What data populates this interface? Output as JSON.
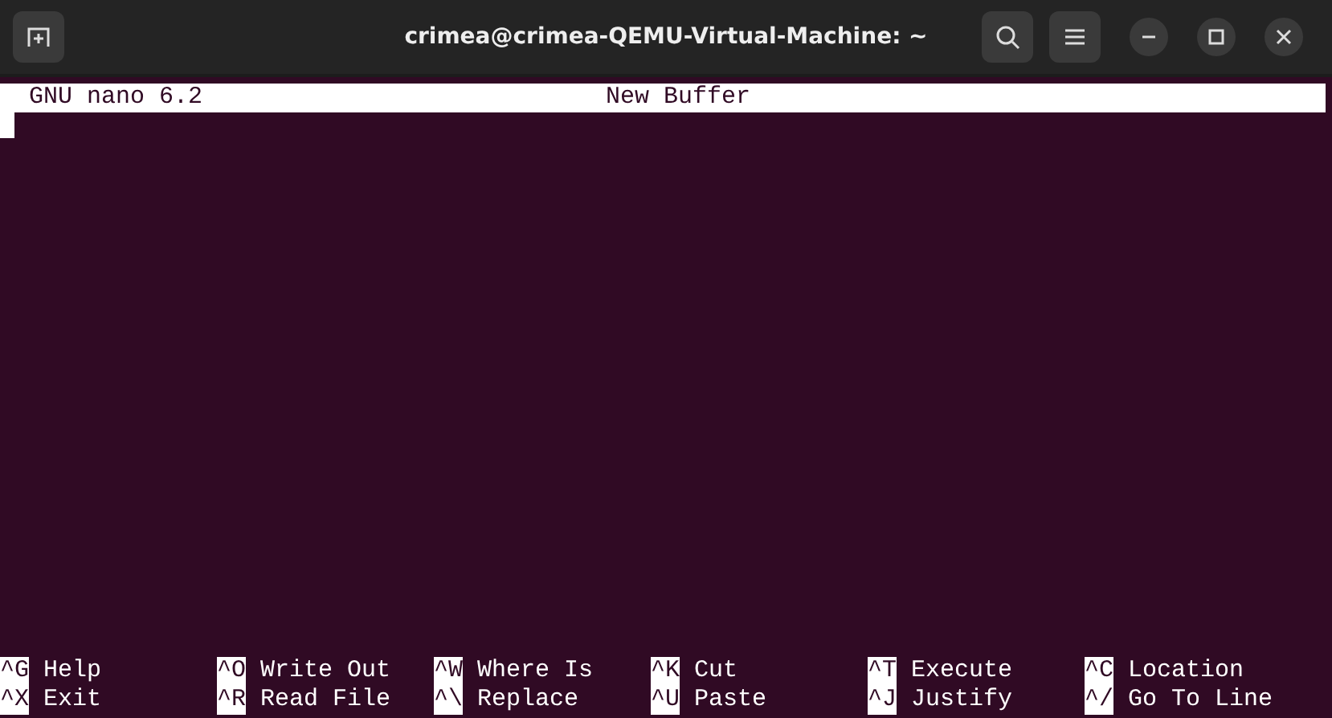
{
  "window": {
    "title": "crimea@crimea-QEMU-Virtual-Machine: ~"
  },
  "nano": {
    "version": "GNU nano 6.2",
    "buffer": "New Buffer"
  },
  "shortcuts": [
    [
      {
        "key": "^G",
        "label": "Help"
      },
      {
        "key": "^O",
        "label": "Write Out"
      },
      {
        "key": "^W",
        "label": "Where Is"
      },
      {
        "key": "^K",
        "label": "Cut"
      },
      {
        "key": "^T",
        "label": "Execute"
      },
      {
        "key": "^C",
        "label": "Location"
      }
    ],
    [
      {
        "key": "^X",
        "label": "Exit"
      },
      {
        "key": "^R",
        "label": "Read File"
      },
      {
        "key": "^\\",
        "label": "Replace"
      },
      {
        "key": "^U",
        "label": "Paste"
      },
      {
        "key": "^J",
        "label": "Justify"
      },
      {
        "key": "^/",
        "label": "Go To Line"
      }
    ]
  ]
}
